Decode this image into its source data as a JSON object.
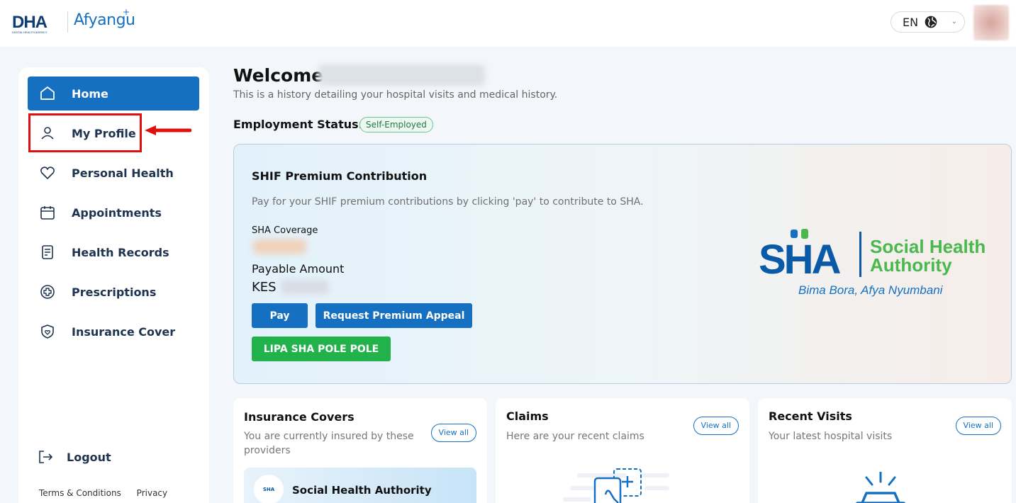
{
  "header": {
    "logo_dha": "DHA",
    "logo_dha_sub": "DIGITAL HEALTH AGENCY",
    "logo_app": "Afyangu",
    "language": "EN"
  },
  "sidebar": {
    "items": [
      {
        "label": "Home",
        "icon": "home-icon"
      },
      {
        "label": "My Profile",
        "icon": "user-icon"
      },
      {
        "label": "Personal Health",
        "icon": "heart-icon"
      },
      {
        "label": "Appointments",
        "icon": "calendar-icon"
      },
      {
        "label": "Health Records",
        "icon": "document-icon"
      },
      {
        "label": "Prescriptions",
        "icon": "plus-circle-icon"
      },
      {
        "label": "Insurance Cover",
        "icon": "shield-icon"
      }
    ],
    "logout": "Logout",
    "terms": "Terms & Conditions",
    "privacy": "Privacy"
  },
  "main": {
    "welcome": "Welcome",
    "subtitle": "This is a history detailing your hospital visits and medical history.",
    "employment_label": "Employment Status:",
    "employment_value": "Self-Employed",
    "premium": {
      "title": "SHIF Premium Contribution",
      "description": "Pay for your SHIF premium contributions by clicking 'pay' to contribute to SHA.",
      "coverage_label": "SHA Coverage",
      "payable_label": "Payable Amount",
      "currency": "KES",
      "pay_button": "Pay",
      "appeal_button": "Request Premium Appeal",
      "lipa_button": "LIPA SHA POLE POLE",
      "logo_text": "SHA",
      "logo_name_line1": "Social Health",
      "logo_name_line2": "Authority",
      "logo_tagline": "Bima Bora, Afya Nyumbani"
    },
    "cards": {
      "insurance": {
        "title": "Insurance Covers",
        "subtitle": "You are currently insured by these providers",
        "view_all": "View all",
        "provider_name": "Social Health Authority",
        "provider_logo_text": "SHA"
      },
      "claims": {
        "title": "Claims",
        "subtitle": "Here are your recent claims",
        "view_all": "View all"
      },
      "visits": {
        "title": "Recent Visits",
        "subtitle": "Your latest hospital visits",
        "view_all": "View all"
      }
    }
  },
  "colors": {
    "primary": "#1670c2",
    "success": "#22b24c",
    "highlight": "#e01010"
  }
}
